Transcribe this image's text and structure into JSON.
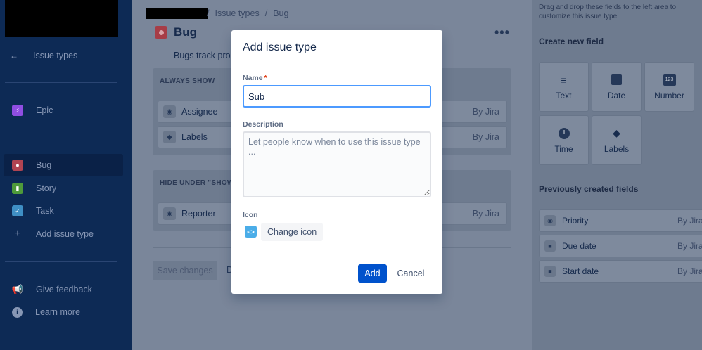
{
  "sidebar": {
    "back_label": "Issue types",
    "items": [
      {
        "label": "Epic",
        "icon": "lightning-icon",
        "color": "#904ee2"
      },
      {
        "label": "Bug",
        "icon": "bug-icon",
        "color": "#e5493a"
      },
      {
        "label": "Story",
        "icon": "bookmark-icon",
        "color": "#63ba3c"
      },
      {
        "label": "Task",
        "icon": "checkmark-icon",
        "color": "#4bade8"
      },
      {
        "label": "Add issue type",
        "icon": "plus-icon"
      }
    ],
    "feedback_label": "Give feedback",
    "learn_label": "Learn more"
  },
  "breadcrumb": {
    "sep1": "/",
    "link": "Issue types",
    "sep2": "/",
    "current": "Bug"
  },
  "page": {
    "title": "Bug",
    "description": "Bugs track problems or errors.",
    "more_label": "•••",
    "always_show": {
      "header": "ALWAYS SHOW",
      "fields": [
        {
          "label": "Assignee",
          "by": "By Jira",
          "icon": "user-icon"
        },
        {
          "label": "Labels",
          "by": "By Jira",
          "icon": "tag-icon"
        }
      ]
    },
    "hide_under": {
      "header": "HIDE UNDER \"SHOW",
      "fields": [
        {
          "label": "Reporter",
          "by": "By Jira",
          "icon": "user-icon"
        }
      ]
    },
    "save_label": "Save changes",
    "discard_label": "D"
  },
  "right_panel": {
    "hint": "Drag and drop these fields to the left area to customize this issue type.",
    "create_header": "Create new field",
    "tiles": [
      {
        "label": "Text",
        "icon": "text-icon"
      },
      {
        "label": "Date",
        "icon": "calendar-icon"
      },
      {
        "label": "Number",
        "icon": "number-icon",
        "glyph": "123"
      },
      {
        "label": "Time",
        "icon": "clock-icon"
      },
      {
        "label": "Labels",
        "icon": "tag-icon"
      }
    ],
    "prev_header": "Previously created fields",
    "prev_fields": [
      {
        "label": "Priority",
        "by": "By Jira",
        "icon": "priority-icon"
      },
      {
        "label": "Due date",
        "by": "By Jira",
        "icon": "calendar-icon"
      },
      {
        "label": "Start date",
        "by": "By Jira",
        "icon": "calendar-icon"
      }
    ]
  },
  "modal": {
    "title": "Add issue type",
    "name_label": "Name",
    "required_mark": "*",
    "name_value": "Sub",
    "description_label": "Description",
    "description_placeholder": "Let people know when to use this issue type ...",
    "icon_label": "Icon",
    "icon_glyph": "<>",
    "change_icon_label": "Change icon",
    "add_label": "Add",
    "cancel_label": "Cancel"
  },
  "colors": {
    "primary": "#0052cc",
    "focus": "#4c9aff",
    "sidebar_bg": "#0d2a55",
    "overlay": "#7a869a"
  }
}
